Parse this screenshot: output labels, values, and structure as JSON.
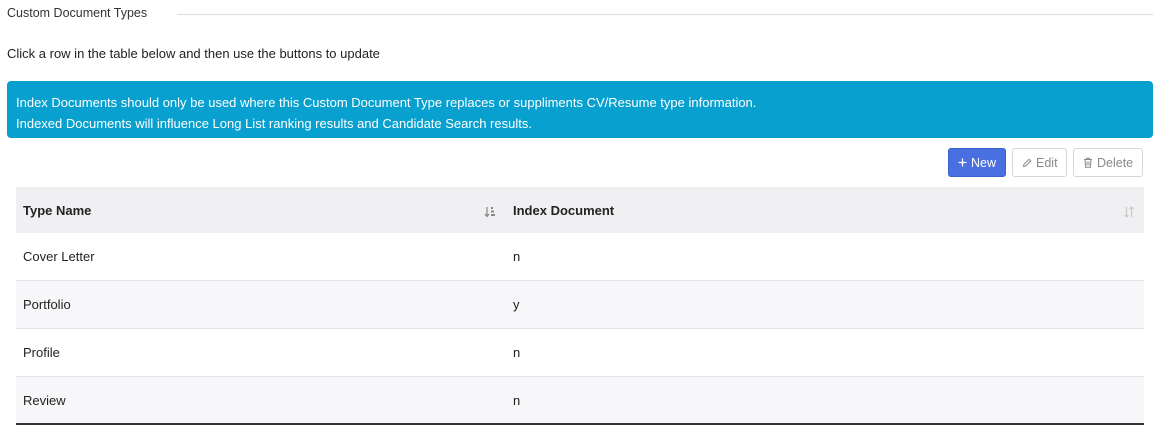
{
  "section": {
    "legend": "Custom Document Types",
    "instructions": "Click a row in the table below and then use the buttons to update"
  },
  "alert": {
    "line1": "Index Documents should only be used where this Custom Document Type replaces or suppliments CV/Resume type information.",
    "line2": "Indexed Documents will influence Long List ranking results and Candidate Search results.",
    "color": "#08a0cf"
  },
  "toolbar": {
    "new_label": "New",
    "edit_label": "Edit",
    "delete_label": "Delete",
    "new_icon": "plus-icon",
    "edit_icon": "pencil-icon",
    "delete_icon": "trash-icon",
    "accent": "#4a6fe0"
  },
  "table": {
    "columns": [
      "Type Name",
      "Index Document"
    ],
    "sort": {
      "column": "Type Name",
      "direction": "ascending"
    },
    "rows": [
      {
        "type_name": "Cover Letter",
        "index_document": "n"
      },
      {
        "type_name": "Portfolio",
        "index_document": "y"
      },
      {
        "type_name": "Profile",
        "index_document": "n"
      },
      {
        "type_name": "Review",
        "index_document": "n"
      }
    ]
  }
}
